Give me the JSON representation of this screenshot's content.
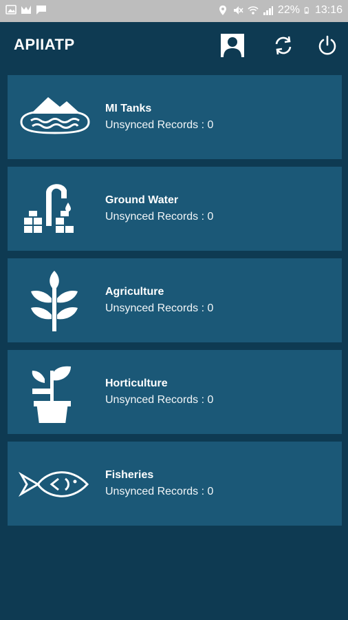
{
  "status_bar": {
    "battery": "22%",
    "time": "13:16",
    "icons": [
      "image-icon",
      "chart-icon",
      "message-icon",
      "location-icon",
      "mute-icon",
      "wifi-icon",
      "signal-icon",
      "battery-icon"
    ]
  },
  "app_bar": {
    "title": "APIIATP",
    "actions": [
      "profile-icon",
      "sync-icon",
      "power-icon"
    ]
  },
  "cards": [
    {
      "icon": "tank-icon",
      "title": "MI Tanks",
      "subtitle": "Unsynced Records : 0"
    },
    {
      "icon": "tap-icon",
      "title": "Ground Water",
      "subtitle": "Unsynced Records : 0"
    },
    {
      "icon": "wheat-icon",
      "title": "Agriculture",
      "subtitle": "Unsynced Records : 0"
    },
    {
      "icon": "plant-pot-icon",
      "title": "Horticulture",
      "subtitle": "Unsynced Records : 0"
    },
    {
      "icon": "fish-icon",
      "title": "Fisheries",
      "subtitle": "Unsynced Records : 0"
    }
  ],
  "colors": {
    "background": "#0e3a52",
    "card": "#1b5877",
    "status_bar": "#bdbdbd",
    "text": "#ffffff"
  }
}
